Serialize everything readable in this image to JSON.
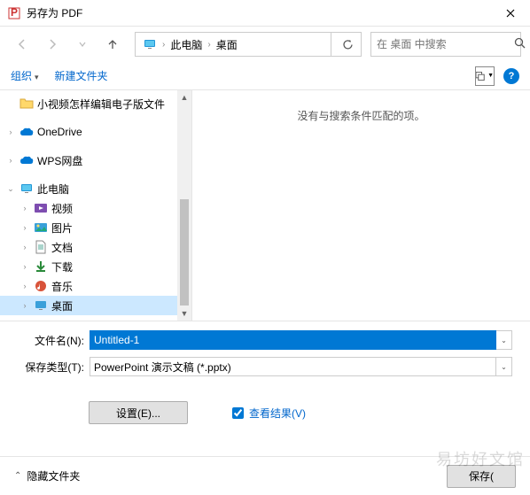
{
  "title": "另存为 PDF",
  "breadcrumb": {
    "root": "此电脑",
    "current": "桌面"
  },
  "search": {
    "placeholder": "在 桌面 中搜索"
  },
  "toolbar": {
    "organize": "组织",
    "newfolder": "新建文件夹"
  },
  "content": {
    "empty": "没有与搜索条件匹配的项。"
  },
  "tree": {
    "folder1": "小视频怎样编辑电子版文件",
    "onedrive": "OneDrive",
    "wps": "WPS网盘",
    "thispc": "此电脑",
    "videos": "视频",
    "pictures": "图片",
    "documents": "文档",
    "downloads": "下载",
    "music": "音乐",
    "desktop": "桌面"
  },
  "form": {
    "filename_label": "文件名(N):",
    "filename_value": "Untitled-1",
    "filetype_label": "保存类型(T):",
    "filetype_value": "PowerPoint 演示文稿 (*.pptx)"
  },
  "options": {
    "settings": "设置(E)...",
    "view_results": "查看结果(V)"
  },
  "footer": {
    "hide_folders": "隐藏文件夹",
    "save": "保存("
  },
  "watermark": "易坊好文馆"
}
